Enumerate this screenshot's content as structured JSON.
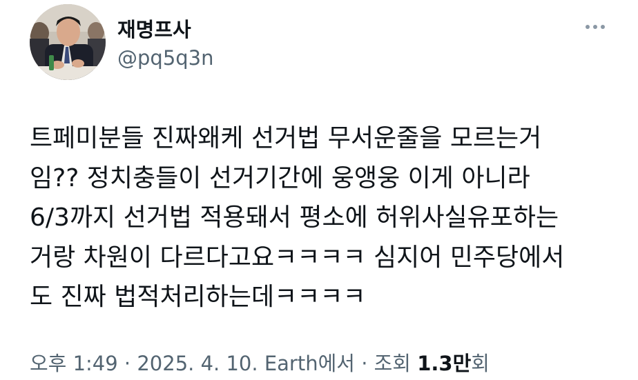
{
  "author": {
    "display_name": "재명프사",
    "handle": "@pq5q3n",
    "avatar_icon": "profile-photo"
  },
  "more_icon": "more-horizontal-icon",
  "tweet": {
    "text": "트페미분들 진짜왜케 선거법 무서운줄을 모르는거\n임?? 정치충들이 선거기간에 웅앵웅 이게 아니라\n6/3까지 선거법 적용돼서 평소에 허위사실유포하는\n거랑 차원이 다르다고요ㅋㅋㅋㅋ 심지어 민주당에서\n도 진짜 법적처리하는데ㅋㅋㅋㅋ"
  },
  "meta": {
    "timestamp": "오후 1:49 · 2025. 4. 10.",
    "source": "Earth에서",
    "views_label": "조회",
    "views_count": "1.3만",
    "views_suffix": "회"
  },
  "colors": {
    "text_primary": "#0f1419",
    "text_secondary": "#536471",
    "background": "#ffffff"
  }
}
